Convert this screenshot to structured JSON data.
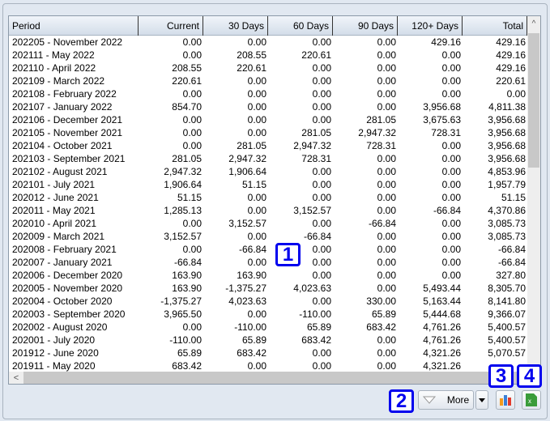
{
  "table": {
    "columns": [
      "Period",
      "Current",
      "30 Days",
      "60 Days",
      "90 Days",
      "120+ Days",
      "Total"
    ],
    "rows": [
      [
        "202205 - November 2022",
        "0.00",
        "0.00",
        "0.00",
        "0.00",
        "429.16",
        "429.16"
      ],
      [
        "202111 - May 2022",
        "0.00",
        "208.55",
        "220.61",
        "0.00",
        "0.00",
        "429.16"
      ],
      [
        "202110 - April 2022",
        "208.55",
        "220.61",
        "0.00",
        "0.00",
        "0.00",
        "429.16"
      ],
      [
        "202109 - March 2022",
        "220.61",
        "0.00",
        "0.00",
        "0.00",
        "0.00",
        "220.61"
      ],
      [
        "202108 - February 2022",
        "0.00",
        "0.00",
        "0.00",
        "0.00",
        "0.00",
        "0.00"
      ],
      [
        "202107 - January 2022",
        "854.70",
        "0.00",
        "0.00",
        "0.00",
        "3,956.68",
        "4,811.38"
      ],
      [
        "202106 - December 2021",
        "0.00",
        "0.00",
        "0.00",
        "281.05",
        "3,675.63",
        "3,956.68"
      ],
      [
        "202105 - November 2021",
        "0.00",
        "0.00",
        "281.05",
        "2,947.32",
        "728.31",
        "3,956.68"
      ],
      [
        "202104 - October 2021",
        "0.00",
        "281.05",
        "2,947.32",
        "728.31",
        "0.00",
        "3,956.68"
      ],
      [
        "202103 - September 2021",
        "281.05",
        "2,947.32",
        "728.31",
        "0.00",
        "0.00",
        "3,956.68"
      ],
      [
        "202102 - August 2021",
        "2,947.32",
        "1,906.64",
        "0.00",
        "0.00",
        "0.00",
        "4,853.96"
      ],
      [
        "202101 - July 2021",
        "1,906.64",
        "51.15",
        "0.00",
        "0.00",
        "0.00",
        "1,957.79"
      ],
      [
        "202012 - June 2021",
        "51.15",
        "0.00",
        "0.00",
        "0.00",
        "0.00",
        "51.15"
      ],
      [
        "202011 - May 2021",
        "1,285.13",
        "0.00",
        "3,152.57",
        "0.00",
        "-66.84",
        "4,370.86"
      ],
      [
        "202010 - April 2021",
        "0.00",
        "3,152.57",
        "0.00",
        "-66.84",
        "0.00",
        "3,085.73"
      ],
      [
        "202009 - March 2021",
        "3,152.57",
        "0.00",
        "-66.84",
        "0.00",
        "0.00",
        "3,085.73"
      ],
      [
        "202008 - February 2021",
        "0.00",
        "-66.84",
        "0.00",
        "0.00",
        "0.00",
        "-66.84"
      ],
      [
        "202007 - January 2021",
        "-66.84",
        "0.00",
        "0.00",
        "0.00",
        "0.00",
        "-66.84"
      ],
      [
        "202006 - December 2020",
        "163.90",
        "163.90",
        "0.00",
        "0.00",
        "0.00",
        "327.80"
      ],
      [
        "202005 - November 2020",
        "163.90",
        "-1,375.27",
        "4,023.63",
        "0.00",
        "5,493.44",
        "8,305.70"
      ],
      [
        "202004 - October 2020",
        "-1,375.27",
        "4,023.63",
        "0.00",
        "330.00",
        "5,163.44",
        "8,141.80"
      ],
      [
        "202003 - September 2020",
        "3,965.50",
        "0.00",
        "-110.00",
        "65.89",
        "5,444.68",
        "9,366.07"
      ],
      [
        "202002 - August 2020",
        "0.00",
        "-110.00",
        "65.89",
        "683.42",
        "4,761.26",
        "5,400.57"
      ],
      [
        "202001 - July 2020",
        "-110.00",
        "65.89",
        "683.42",
        "0.00",
        "4,761.26",
        "5,400.57"
      ],
      [
        "201912 - June 2020",
        "65.89",
        "683.42",
        "0.00",
        "0.00",
        "4,321.26",
        "5,070.57"
      ],
      [
        "201911 - May 2020",
        "683.42",
        "0.00",
        "0.00",
        "0.00",
        "4,321.26",
        ""
      ]
    ]
  },
  "toolbar": {
    "more_label": "More",
    "chart_icon": "bar-chart-icon",
    "excel_icon": "excel-export-icon"
  },
  "badges": [
    "1",
    "2",
    "3",
    "4"
  ],
  "colors": {
    "badge": "#0000ee",
    "header_bg": "#d3dde9",
    "panel_bg": "#e1e8f1"
  }
}
